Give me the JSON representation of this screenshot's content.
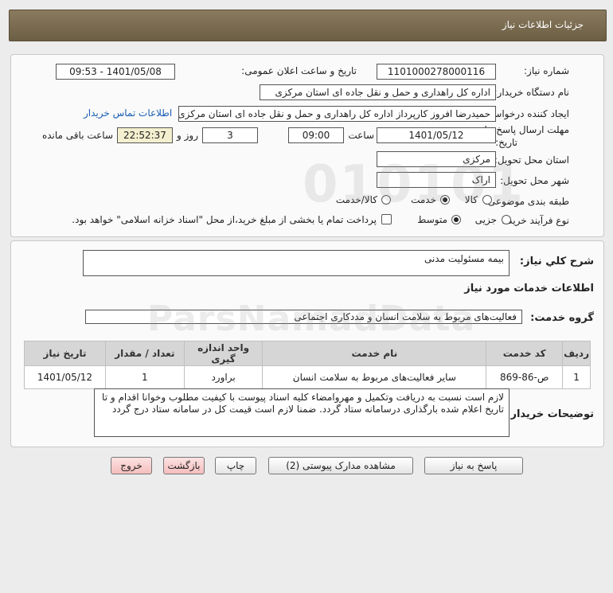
{
  "header": {
    "title": "جزئیات اطلاعات نیاز"
  },
  "info": {
    "need_number_label": "شماره نیاز:",
    "need_number": "1101000278000116",
    "announce_label": "تاریخ و ساعت اعلان عمومی:",
    "announce_value": "1401/05/08 - 09:53",
    "buyer_label": "نام دستگاه خریدار:",
    "buyer_value": "اداره کل راهداری و حمل و نقل جاده ای استان مرکزی",
    "creator_label": "ایجاد کننده درخواست:",
    "creator_value": "حمیدرضا  افروز  کارپرداز اداره کل راهداری و حمل و نقل جاده ای استان مرکزی",
    "contact_link": "اطلاعات تماس خریدار",
    "deadline_label_1": "مهلت ارسال پاسخ: تا",
    "deadline_label_2": "تاریخ:",
    "deadline_date": "1401/05/12",
    "time_label": "ساعت",
    "deadline_time": "09:00",
    "days_value": "3",
    "days_label": "روز و",
    "remaining_value": "22:52:37",
    "remaining_label": "ساعت باقی مانده",
    "province_label": "استان محل تحویل:",
    "province_value": "مرکزی",
    "city_label": "شهر محل تحویل:",
    "city_value": "اراک",
    "category_label": "طبقه بندی موضوعی:",
    "category_options": [
      "کالا",
      "خدمت",
      "کالا/خدمت"
    ],
    "category_selected": "خدمت",
    "process_label": "نوع فرآیند خرید :",
    "process_options": [
      "جزیی",
      "متوسط"
    ],
    "process_selected": "متوسط",
    "payment_note": "پرداخت تمام یا بخشی از مبلغ خرید،از محل \"اسناد خزانه اسلامی\" خواهد بود."
  },
  "description": {
    "summary_label": "شرح کلي نياز:",
    "summary_value": "بیمه مسئولیت مدنی",
    "services_title": "اطلاعات خدمات مورد نیاز",
    "group_label": "گروه خدمت:",
    "group_value": "فعالیت‌های مربوط به سلامت انسان و مددکاری اجتماعی"
  },
  "table": {
    "headers": [
      "ردیف",
      "کد خدمت",
      "نام خدمت",
      "واحد اندازه گیری",
      "تعداد / مقدار",
      "تاریخ نیاز"
    ],
    "rows": [
      [
        "1",
        "ص-86-869",
        "سایر فعالیت‌های مربوط به سلامت انسان",
        "براورد",
        "1",
        "1401/05/12"
      ]
    ]
  },
  "buyer_notes": {
    "label": "توضیحات خریدار:",
    "text": "لازم است نسبت به دریافت وتکمیل و مهروامضاء کلیه اسناد پیوست با کیفیت مطلوب وخوانا اقدام و تا تاریخ اعلام شده بارگذاری درسامانه ستاد گردد. ضمنا لازم است قیمت کل در سامانه ستاد درج گردد"
  },
  "buttons": {
    "reply": "پاسخ به نیاز",
    "attachments": "مشاهده مدارک پیوستی (2)",
    "print": "چاپ",
    "back": "بازگشت",
    "exit": "خروج"
  }
}
